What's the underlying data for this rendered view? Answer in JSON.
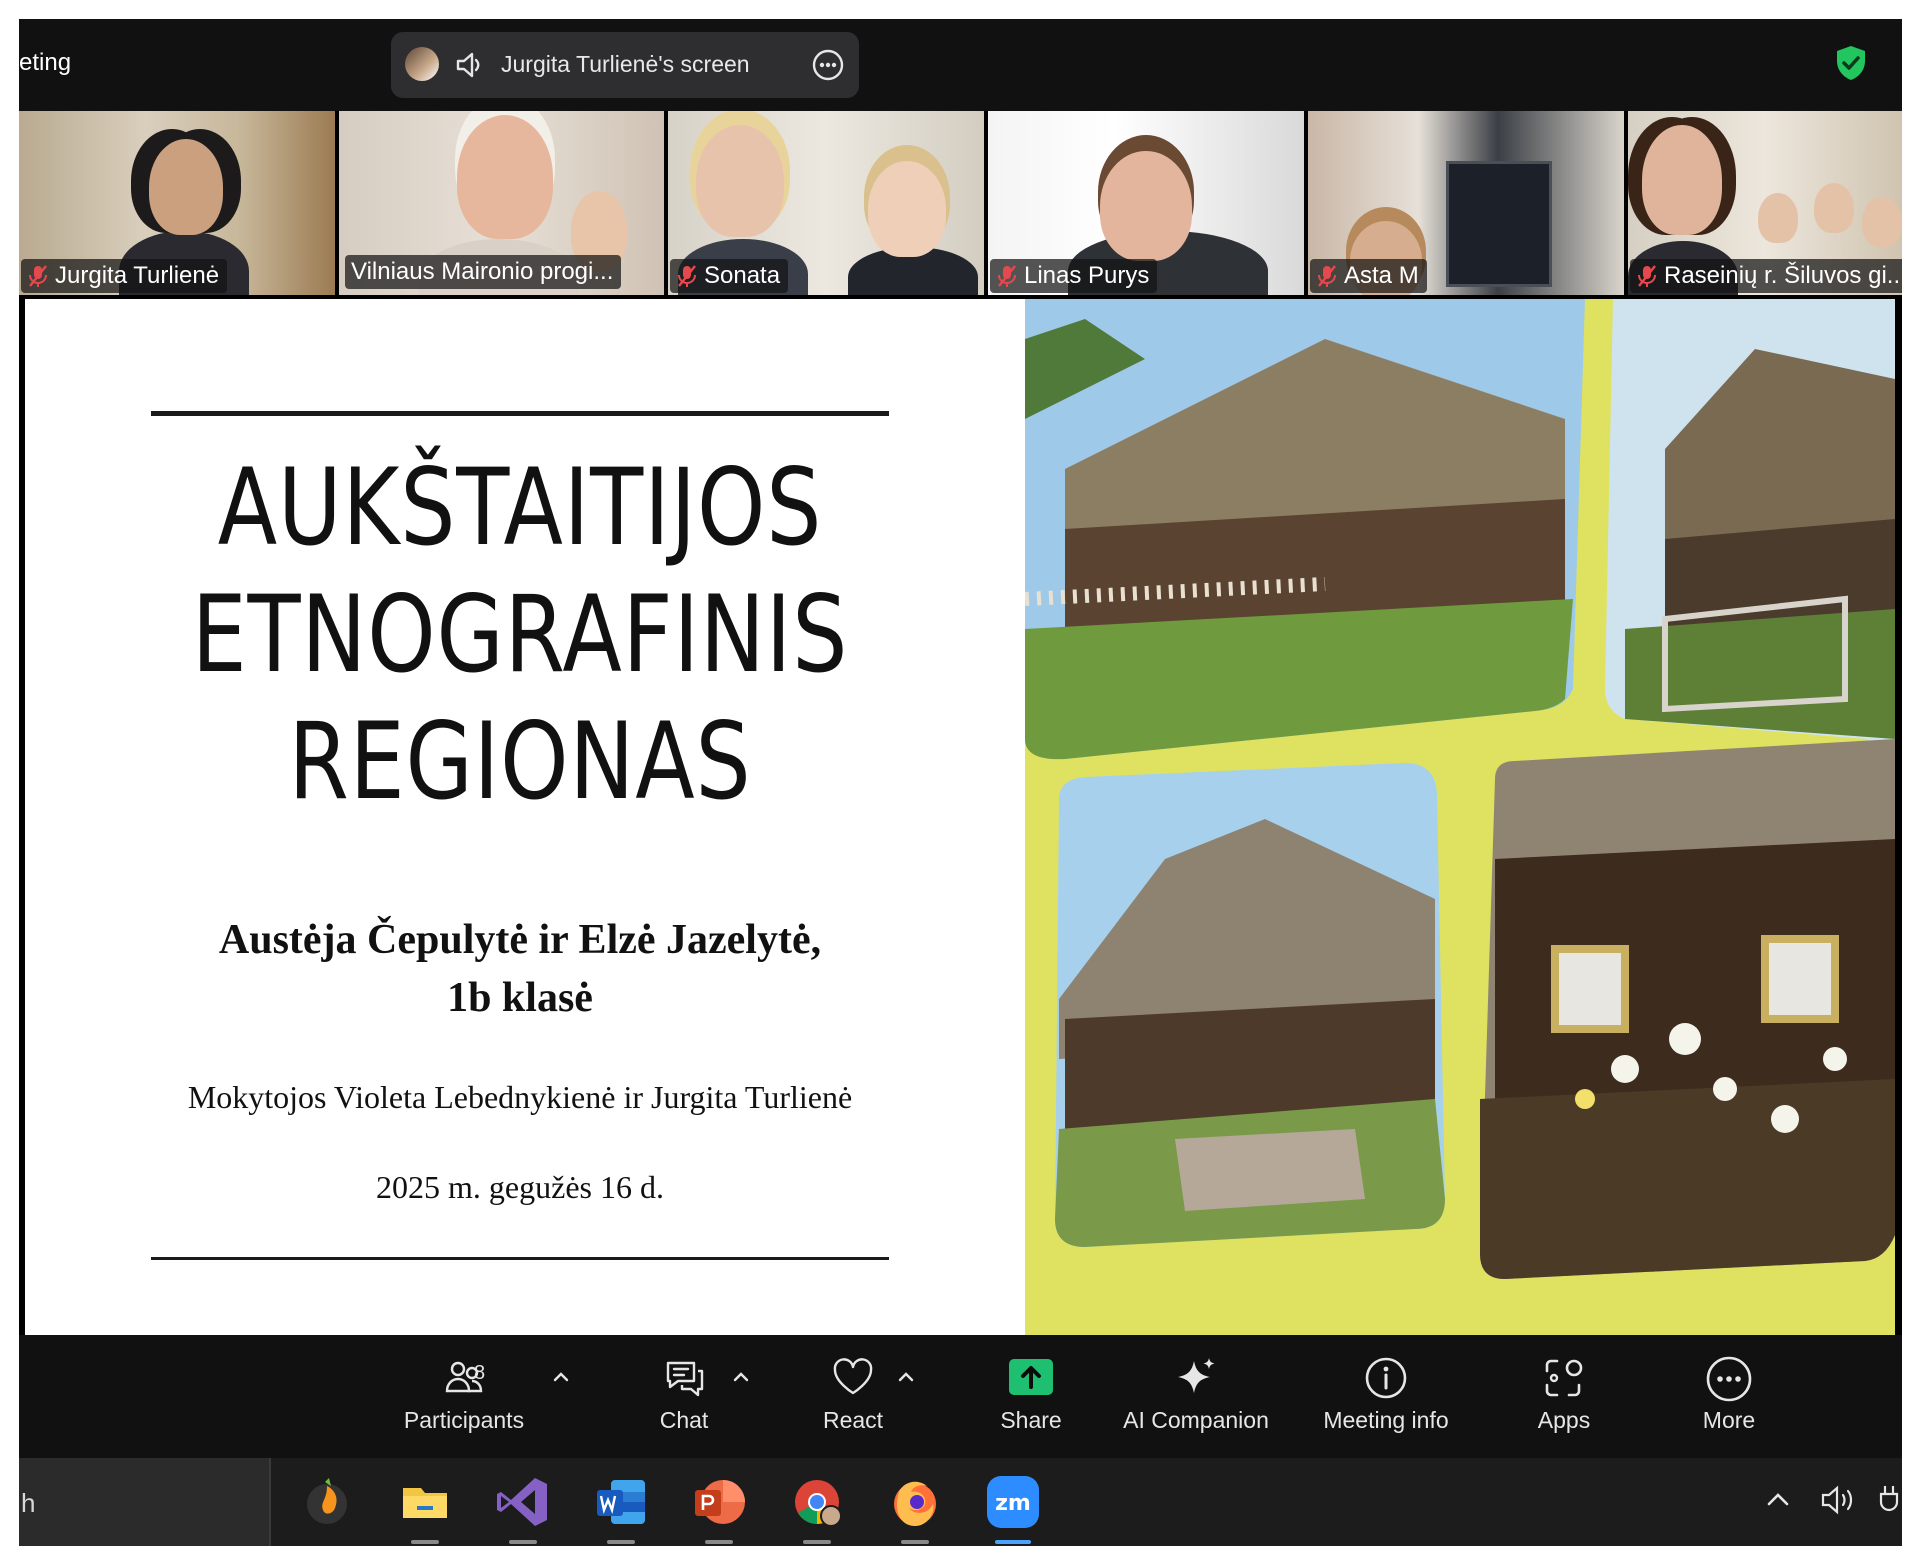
{
  "window": {
    "title": "eting"
  },
  "share_banner": {
    "title": "Jurgita Turlienė's screen"
  },
  "colors": {
    "active_speaker": "#2bd17c",
    "share_green": "#1fbf72",
    "security_green": "#22c55e",
    "collage_frame": "#c5cf2a",
    "mute_red": "#e5484d"
  },
  "participants": [
    {
      "name": "Jurgita Turlienė",
      "muted": true
    },
    {
      "name": "Vilniaus Maironio progi...",
      "muted": false,
      "active_speaker": true
    },
    {
      "name": "Sonata",
      "muted": true
    },
    {
      "name": "Linas Purys",
      "muted": true
    },
    {
      "name": "Asta M",
      "muted": true
    },
    {
      "name": "Raseinių r. Šiluvos gi...",
      "muted": true
    }
  ],
  "slide": {
    "title_lines": [
      "AUKŠTAITIJOS",
      "ETNOGRAFINIS",
      "REGIONAS"
    ],
    "authors_line1": "Austėja Čepulytė ir Elzė Jazelytė,",
    "authors_line2": "1b klasė",
    "teachers": "Mokytojos Violeta Lebednykienė ir Jurgita Turlienė",
    "date": "2025 m. gegužės 16 d."
  },
  "toolbar": {
    "participants_label": "Participants",
    "participants_count": "8",
    "chat_label": "Chat",
    "react_label": "React",
    "share_label": "Share",
    "ai_label": "AI Companion",
    "info_label": "Meeting info",
    "apps_label": "Apps",
    "more_label": "More"
  },
  "taskbar": {
    "search_text": "h",
    "apps": [
      "fl-studio-icon",
      "file-explorer-icon",
      "visual-studio-icon",
      "word-icon",
      "powerpoint-icon",
      "chrome-icon",
      "firefox-icon",
      "zoom-icon"
    ]
  }
}
